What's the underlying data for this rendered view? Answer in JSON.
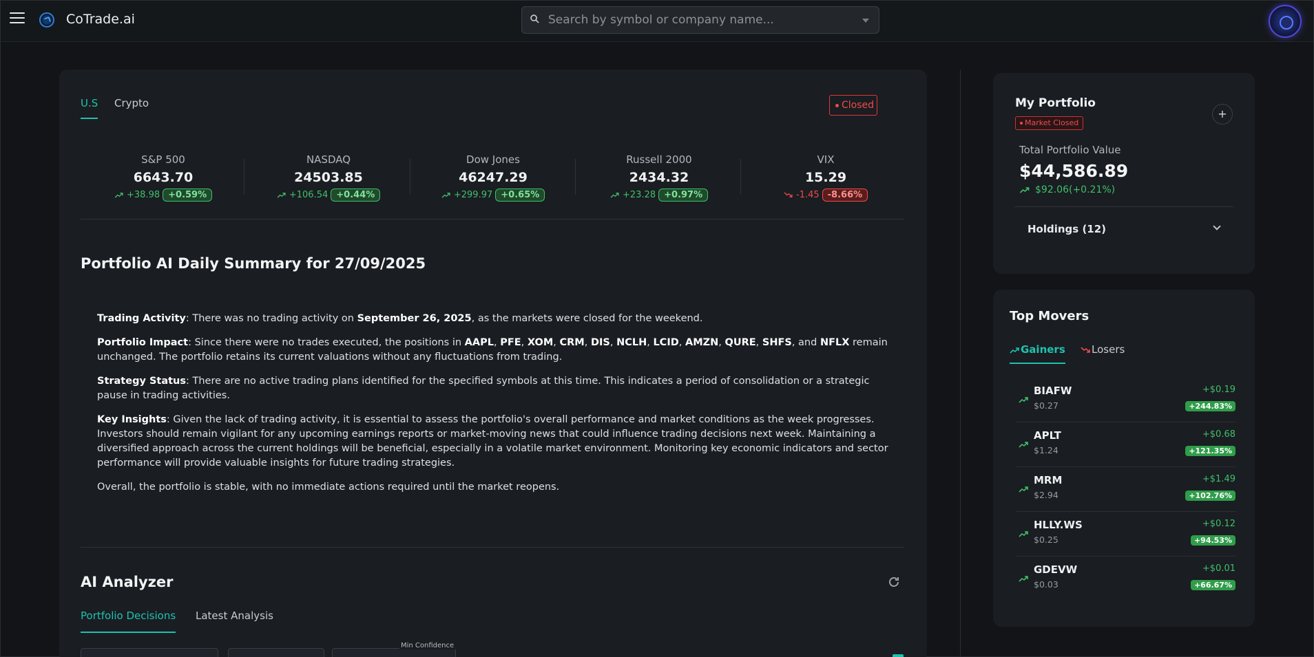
{
  "header": {
    "brand": "CoTrade.ai",
    "search_placeholder": "Search by symbol or company name..."
  },
  "market": {
    "tabs": [
      "U.S",
      "Crypto"
    ],
    "active_tab": "U.S",
    "status": "Closed",
    "indices": [
      {
        "name": "S&P 500",
        "value": "6643.70",
        "change": "+38.98",
        "pct": "+0.59%",
        "direction": "up"
      },
      {
        "name": "NASDAQ",
        "value": "24503.85",
        "change": "+106.54",
        "pct": "+0.44%",
        "direction": "up"
      },
      {
        "name": "Dow Jones",
        "value": "46247.29",
        "change": "+299.97",
        "pct": "+0.65%",
        "direction": "up"
      },
      {
        "name": "Russell 2000",
        "value": "2434.32",
        "change": "+23.28",
        "pct": "+0.97%",
        "direction": "up"
      },
      {
        "name": "VIX",
        "value": "15.29",
        "change": "-1.45",
        "pct": "-8.66%",
        "direction": "down"
      }
    ]
  },
  "summary": {
    "title": "Portfolio AI Daily Summary for 27/09/2025",
    "trading_activity_label": "Trading Activity",
    "trading_activity_pre": ": There was no trading activity on ",
    "trading_activity_date": "September 26, 2025",
    "trading_activity_post": ", as the markets were closed for the weekend.",
    "impact_label": "Portfolio Impact",
    "impact_pre": ": Since there were no trades executed, the positions in ",
    "impact_symbols": [
      "AAPL",
      "PFE",
      "XOM",
      "CRM",
      "DIS",
      "NCLH",
      "LCID",
      "AMZN",
      "QURE",
      "SHFS"
    ],
    "impact_and": ", and ",
    "impact_last_symbol": "NFLX",
    "impact_post": " remain unchanged. The portfolio retains its current valuations without any fluctuations from trading.",
    "strategy_label": "Strategy Status",
    "strategy_text": ": There are no active trading plans identified for the specified symbols at this time. This indicates a period of consolidation or a strategic pause in trading activities.",
    "insights_label": "Key Insights",
    "insights_text": ": Given the lack of trading activity, it is essential to assess the portfolio's overall performance and market conditions as the week progresses. Investors should remain vigilant for any upcoming earnings reports or market-moving news that could influence trading decisions next week. Maintaining a diversified approach across the current holdings will be beneficial, especially in a volatile market environment. Monitoring key economic indicators and sector performance will provide valuable insights for future trading strategies.",
    "overall_text": "Overall, the portfolio is stable, with no immediate actions required until the market reopens."
  },
  "analyzer": {
    "title": "AI Analyzer",
    "tabs": [
      "Portfolio Decisions",
      "Latest Analysis"
    ],
    "active_tab": "Portfolio Decisions",
    "filter_label": "Min Confidence"
  },
  "portfolio": {
    "title": "My Portfolio",
    "status": "Market Closed",
    "value_label": "Total Portfolio Value",
    "value": "$44,586.89",
    "change": "$92.06(+0.21%)",
    "holdings_label": "Holdings (12)"
  },
  "movers": {
    "title": "Top Movers",
    "tabs": [
      "Gainers",
      "Losers"
    ],
    "active_tab": "Gainers",
    "items": [
      {
        "symbol": "BIAFW",
        "price": "$0.27",
        "change": "+$0.19",
        "pct": "+244.83%"
      },
      {
        "symbol": "APLT",
        "price": "$1.24",
        "change": "+$0.68",
        "pct": "+121.35%"
      },
      {
        "symbol": "MRM",
        "price": "$2.94",
        "change": "+$1.49",
        "pct": "+102.76%"
      },
      {
        "symbol": "HLLY.WS",
        "price": "$0.25",
        "change": "+$0.12",
        "pct": "+94.53%"
      },
      {
        "symbol": "GDEVW",
        "price": "$0.03",
        "change": "+$0.01",
        "pct": "+66.67%"
      }
    ]
  },
  "colors": {
    "accent": "#1fc2b0",
    "positive": "#3fc06c",
    "negative": "#ef4b4b",
    "background": "#121417",
    "card": "#1a1d21"
  }
}
